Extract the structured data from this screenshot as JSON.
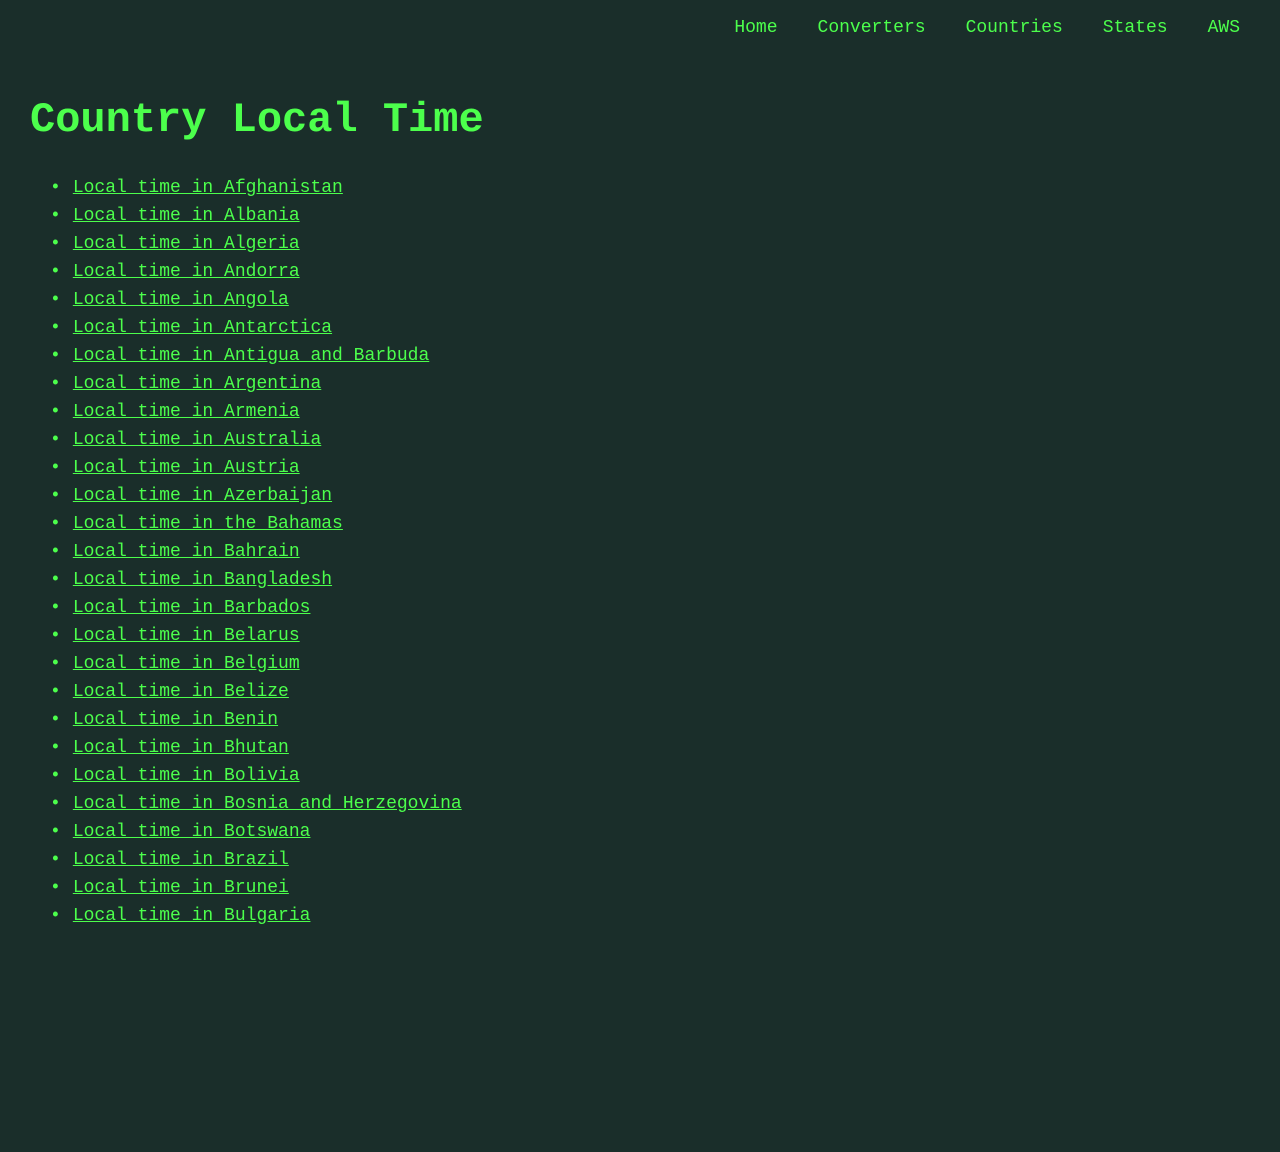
{
  "nav": {
    "home": "Home",
    "converters": "Converters",
    "countries": "Countries",
    "states": "States",
    "aws": "AWS"
  },
  "page": {
    "title": "Country Local Time"
  },
  "countries": [
    "Local time in Afghanistan",
    "Local time in Albania",
    "Local time in Algeria",
    "Local time in Andorra",
    "Local time in Angola",
    "Local time in Antarctica",
    "Local time in Antigua and Barbuda",
    "Local time in Argentina",
    "Local time in Armenia",
    "Local time in Australia",
    "Local time in Austria",
    "Local time in Azerbaijan",
    "Local time in the Bahamas",
    "Local time in Bahrain",
    "Local time in Bangladesh",
    "Local time in Barbados",
    "Local time in Belarus",
    "Local time in Belgium",
    "Local time in Belize",
    "Local time in Benin",
    "Local time in Bhutan",
    "Local time in Bolivia",
    "Local time in Bosnia and Herzegovina",
    "Local time in Botswana",
    "Local time in Brazil",
    "Local time in Brunei",
    "Local time in Bulgaria"
  ]
}
